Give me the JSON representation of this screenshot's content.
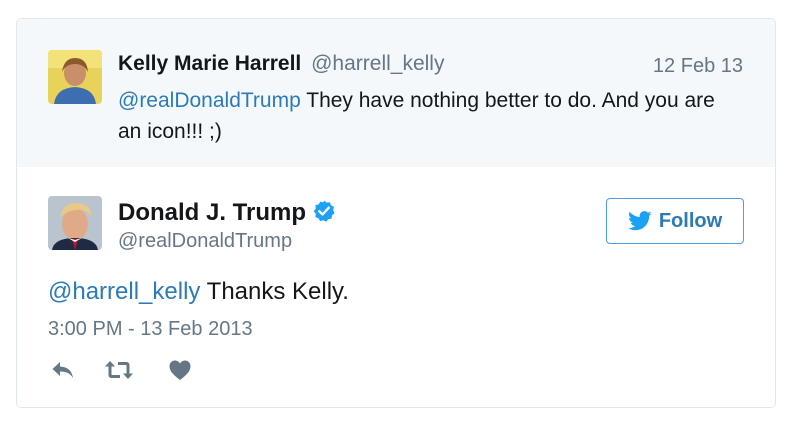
{
  "parent_tweet": {
    "author_name": "Kelly Marie Harrell",
    "author_handle": "@harrell_kelly",
    "date": "12 Feb 13",
    "mention": "@realDonaldTrump",
    "text": " They have nothing better to do. And you are an icon!!! ;)"
  },
  "main_tweet": {
    "author_name": "Donald J. Trump",
    "author_handle": "@realDonaldTrump",
    "follow_label": "Follow",
    "mention": "@harrell_kelly",
    "text": " Thanks Kelly.",
    "timestamp": "3:00 PM - 13 Feb 2013"
  },
  "colors": {
    "link": "#2b7bb9",
    "verified": "#1da1f2",
    "muted": "#657786",
    "action_icon": "#657786"
  },
  "icons": {
    "reply": "reply-icon",
    "retweet": "retweet-icon",
    "like": "heart-icon",
    "verified": "verified-badge-icon",
    "bird": "twitter-bird-icon"
  }
}
